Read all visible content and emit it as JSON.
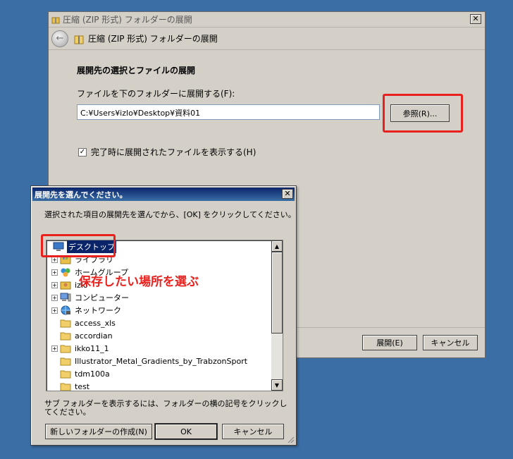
{
  "wizard": {
    "title": "圧縮 (ZIP 形式) フォルダーの展開",
    "nav_title": "圧縮 (ZIP 形式) フォルダーの展開",
    "section_heading": "展開先の選択とファイルの展開",
    "dest_label": "ファイルを下のフォルダーに展開する(F):",
    "dest_value": "C:¥Users¥izlo¥Desktop¥資料01",
    "browse_label": "参照(R)...",
    "show_files_label": "完了時に展開されたファイルを表示する(H)",
    "show_files_checked": true,
    "extract_label": "展開(E)",
    "cancel_label": "キャンセル"
  },
  "dialog": {
    "title": "展開先を選んでください。",
    "instruction": "選択された項目の展開先を選んでから、[OK] をクリックしてください。",
    "tree": [
      {
        "label": "デスクトップ",
        "icon": "desktop-icon",
        "expandable": false,
        "selected": true
      },
      {
        "label": "ライブラリ",
        "icon": "library-icon",
        "expandable": true
      },
      {
        "label": "ホームグループ",
        "icon": "homegroup-icon",
        "expandable": true
      },
      {
        "label": "izlo",
        "icon": "user-folder-icon",
        "expandable": true
      },
      {
        "label": "コンピューター",
        "icon": "computer-icon",
        "expandable": true
      },
      {
        "label": "ネットワーク",
        "icon": "network-icon",
        "expandable": true
      },
      {
        "label": "access_xls",
        "icon": "folder-icon",
        "expandable": false
      },
      {
        "label": "accordian",
        "icon": "folder-icon",
        "expandable": false
      },
      {
        "label": "ikko11_1",
        "icon": "folder-icon",
        "expandable": true
      },
      {
        "label": "Illustrator_Metal_Gradients_by_TrabzonSport",
        "icon": "folder-icon",
        "expandable": false
      },
      {
        "label": "tdm100a",
        "icon": "folder-icon",
        "expandable": false
      },
      {
        "label": "test",
        "icon": "folder-icon",
        "expandable": false
      }
    ],
    "hint": "サブ フォルダーを表示するには、フォルダーの横の記号をクリックしてください。",
    "new_folder_label": "新しいフォルダーの作成(N)",
    "ok_label": "OK",
    "cancel_label": "キャンセル"
  },
  "annotation": {
    "callout": "保存したい場所を選ぶ",
    "highlight_color": "#e8211e"
  }
}
